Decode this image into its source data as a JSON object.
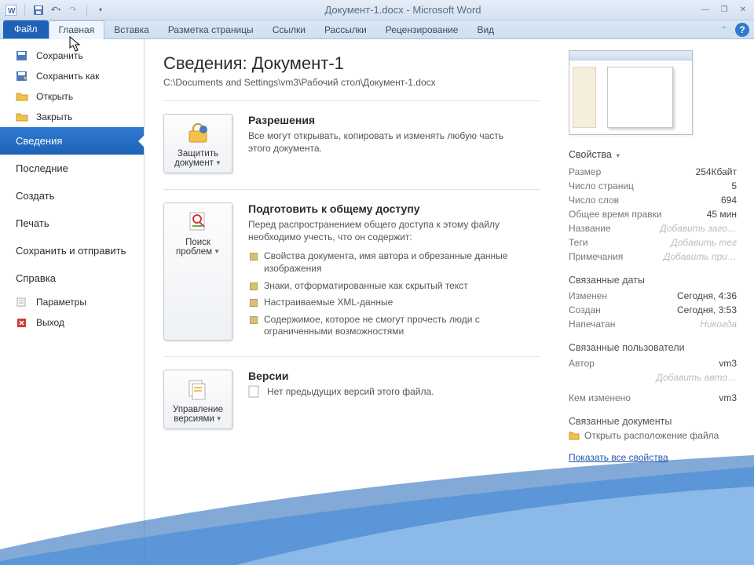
{
  "title": "Документ-1.docx  -  Microsoft Word",
  "ribbon": {
    "file": "Файл",
    "tabs": [
      "Главная",
      "Вставка",
      "Разметка страницы",
      "Ссылки",
      "Рассылки",
      "Рецензирование",
      "Вид"
    ]
  },
  "leftnav": {
    "icon_items": [
      {
        "label": "Сохранить"
      },
      {
        "label": "Сохранить как"
      },
      {
        "label": "Открыть"
      },
      {
        "label": "Закрыть"
      }
    ],
    "main_items": [
      {
        "label": "Сведения",
        "selected": true
      },
      {
        "label": "Последние"
      },
      {
        "label": "Создать"
      },
      {
        "label": "Печать"
      },
      {
        "label": "Сохранить и отправить"
      },
      {
        "label": "Справка"
      }
    ],
    "bottom_items": [
      {
        "label": "Параметры"
      },
      {
        "label": "Выход"
      }
    ]
  },
  "info": {
    "heading": "Сведения: Документ-1",
    "path": "C:\\Documents and Settings\\vm3\\Рабочий стол\\Документ-1.docx",
    "permissions": {
      "title": "Разрешения",
      "desc": "Все могут открывать, копировать и изменять любую часть этого документа.",
      "button": "Защитить документ"
    },
    "prepare": {
      "title": "Подготовить к общему доступу",
      "desc": "Перед распространением общего доступа к этому файлу необходимо учесть, что он содержит:",
      "button": "Поиск проблем",
      "bullets": [
        "Свойства документа, имя автора и обрезанные данные изображения",
        "Знаки, отформатированные как скрытый текст",
        "Настраиваемые XML-данные",
        "Содержимое, которое не смогут прочесть люди с ограниченными возможностями"
      ]
    },
    "versions": {
      "title": "Версии",
      "none": "Нет предыдущих версий этого файла.",
      "button": "Управление версиями"
    }
  },
  "props": {
    "header": "Свойства",
    "rows": [
      {
        "k": "Размер",
        "v": "254Кбайт"
      },
      {
        "k": "Число страниц",
        "v": "5"
      },
      {
        "k": "Число слов",
        "v": "694"
      },
      {
        "k": "Общее время правки",
        "v": "45 мин"
      },
      {
        "k": "Название",
        "v": "Добавить заго…",
        "ph": true
      },
      {
        "k": "Теги",
        "v": "Добавить тег",
        "ph": true
      },
      {
        "k": "Примечания",
        "v": "Добавить при…",
        "ph": true
      }
    ],
    "dates_head": "Связанные даты",
    "dates": [
      {
        "k": "Изменен",
        "v": "Сегодня, 4:36"
      },
      {
        "k": "Создан",
        "v": "Сегодня, 3:53"
      },
      {
        "k": "Напечатан",
        "v": "Никогда",
        "ph": true
      }
    ],
    "users_head": "Связанные пользователи",
    "users": [
      {
        "k": "Автор",
        "v": "vm3"
      },
      {
        "k": "",
        "v": "Добавить авто…",
        "ph": true
      },
      {
        "k": "Кем изменено",
        "v": "vm3"
      }
    ],
    "docs_head": "Связанные документы",
    "open_location": "Открыть расположение файла",
    "show_all": "Показать все свойства"
  }
}
